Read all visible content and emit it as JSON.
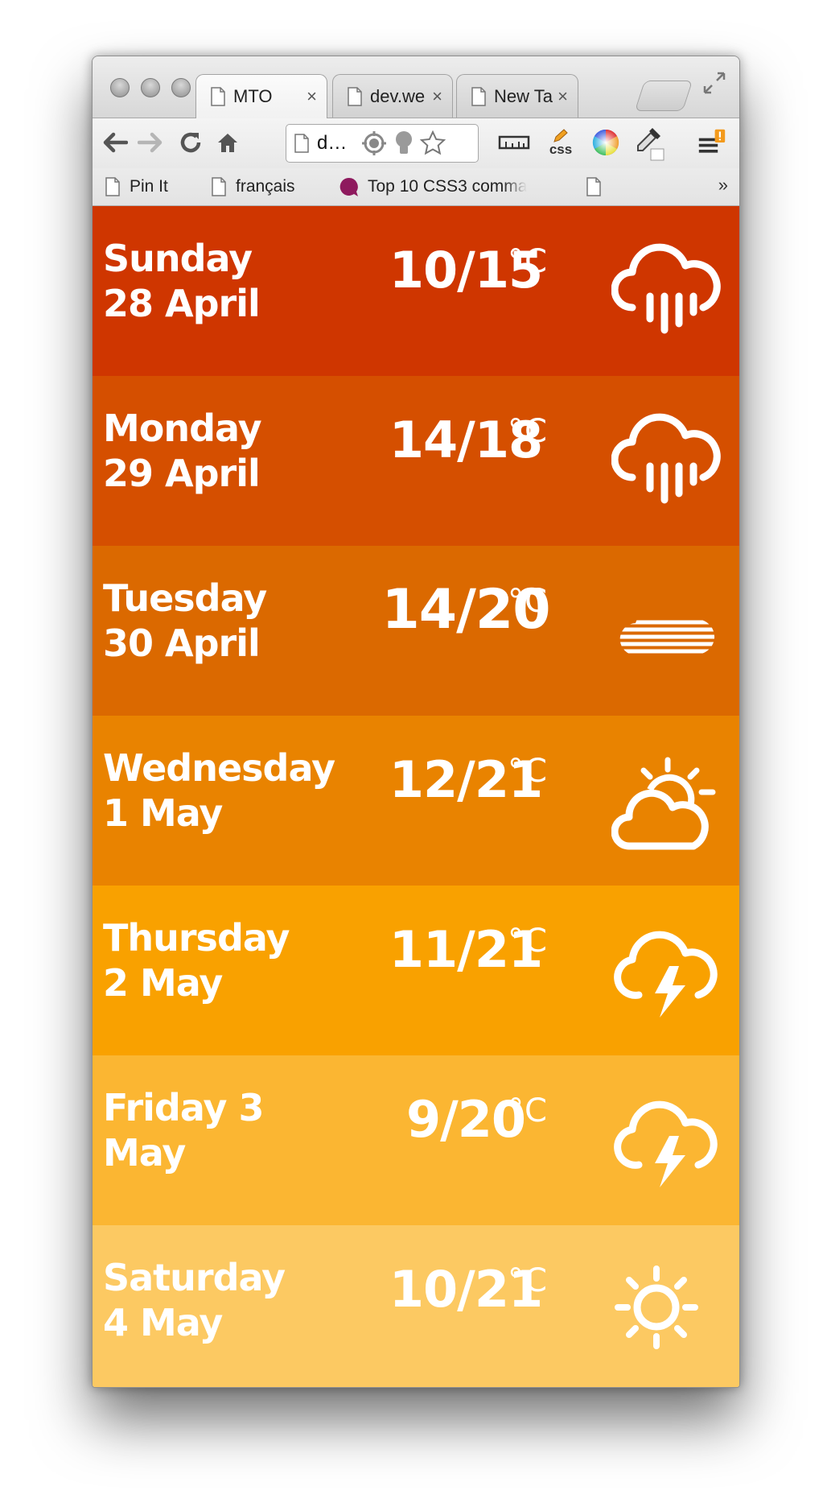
{
  "browser": {
    "tabs": [
      {
        "label": "MTO",
        "active": true
      },
      {
        "label": "dev.we",
        "active": false
      },
      {
        "label": "New Ta",
        "active": false
      }
    ],
    "close_glyph": "×",
    "address_text": "d…",
    "bookmarks": [
      "Pin It",
      "français",
      "Top 10 CSS3 comma",
      ""
    ],
    "bookmarks_more": "»",
    "extension_css_label": "css"
  },
  "forecast": [
    {
      "day": "Sunday",
      "date": "28 April",
      "temp": "10/15",
      "unit": "°C",
      "icon": "rain-cloud-icon",
      "color": "#cf3600"
    },
    {
      "day": "Monday",
      "date": "29 April",
      "temp": "14/18",
      "unit": "°C",
      "icon": "rain-cloud-icon",
      "color": "#d54f00"
    },
    {
      "day": "Tuesday",
      "date": "30 April",
      "temp": "14/20",
      "unit": "°C",
      "icon": "fog-cloud-icon",
      "color": "#db6900"
    },
    {
      "day": "Wednesday",
      "date": "1 May",
      "temp": "12/21",
      "unit": "°C",
      "icon": "sun-behind-cloud-icon",
      "color": "#e98300"
    },
    {
      "day": "Thursday",
      "date": "2 May",
      "temp": "11/21",
      "unit": "°C",
      "icon": "thunderstorm-icon",
      "color": "#f9a100"
    },
    {
      "day": "Friday 3",
      "date": "May",
      "temp": "9/20",
      "unit": "°C",
      "icon": "thunderstorm-icon",
      "color": "#fbb632"
    },
    {
      "day": "Saturday",
      "date": "4 May",
      "temp": "10/21",
      "unit": "°C",
      "icon": "sun-icon",
      "color": "#fcc962"
    }
  ]
}
